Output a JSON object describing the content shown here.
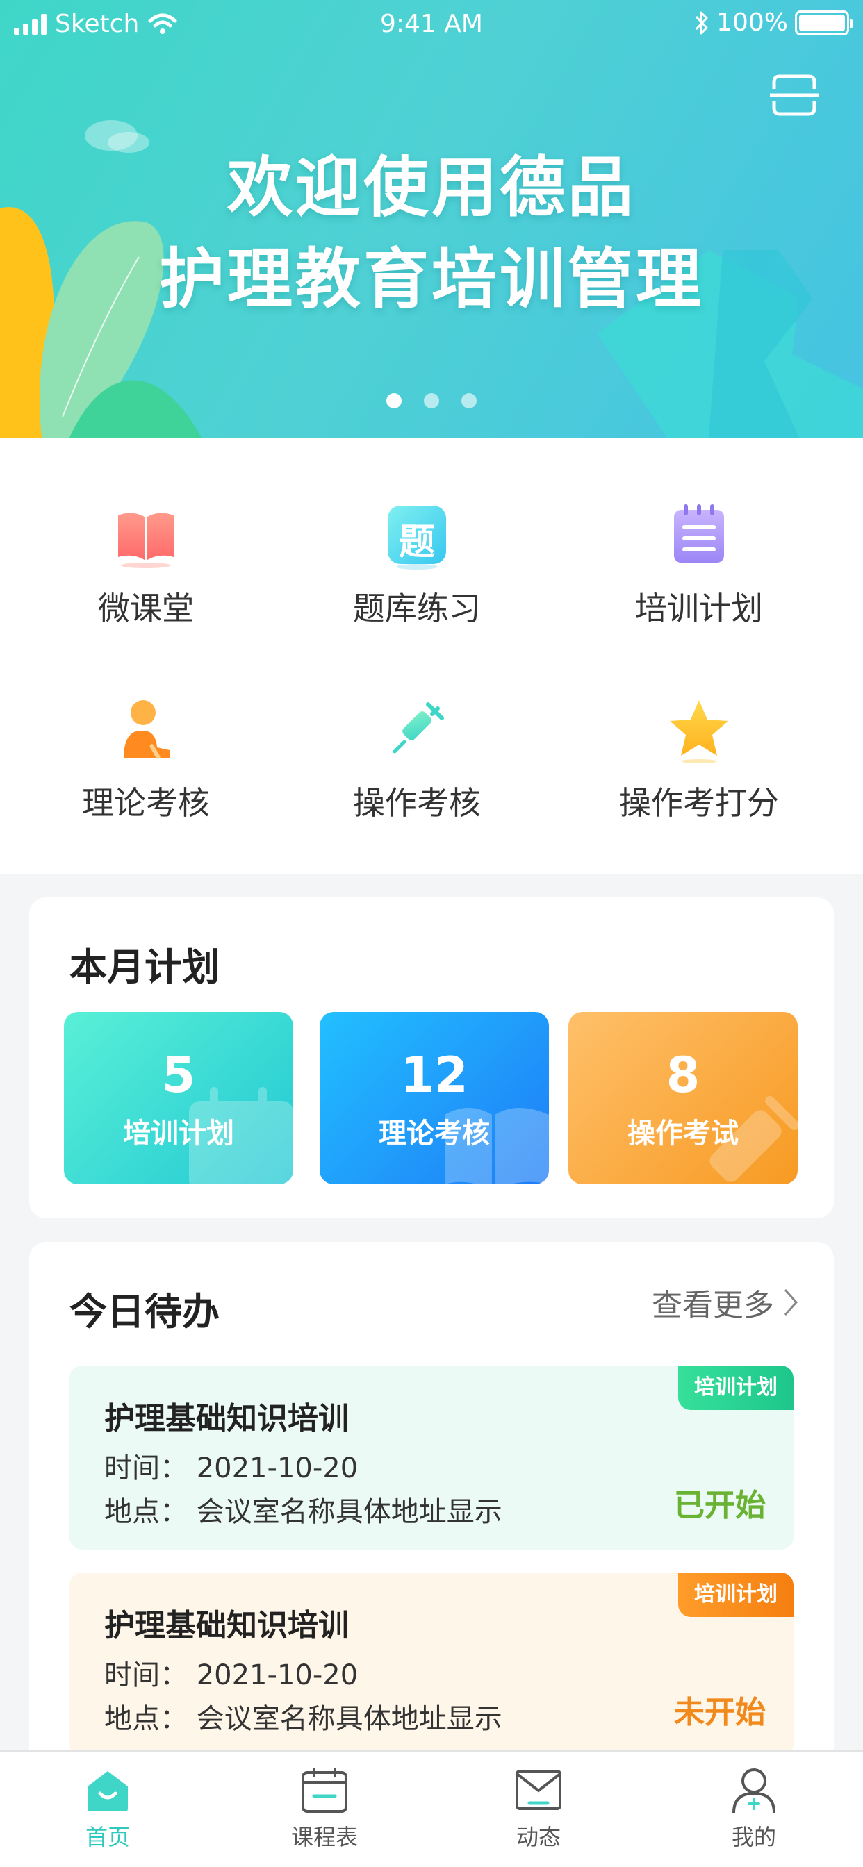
{
  "status_bar": {
    "carrier": "Sketch",
    "time": "9:41 AM",
    "battery": "100%"
  },
  "banner": {
    "title_line1": "欢迎使用德品",
    "title_line2": "护理教育培训管理",
    "dots": 3,
    "active_dot": 0
  },
  "menu": {
    "items": [
      {
        "label": "微课堂",
        "icon": "book-icon"
      },
      {
        "label": "题库练习",
        "icon": "question-bank-icon",
        "glyph": "题"
      },
      {
        "label": "培训计划",
        "icon": "notepad-icon"
      },
      {
        "label": "理论考核",
        "icon": "person-writing-icon"
      },
      {
        "label": "操作考核",
        "icon": "syringe-icon"
      },
      {
        "label": "操作考打分",
        "icon": "star-icon"
      }
    ]
  },
  "plan": {
    "title": "本月计划",
    "stats": [
      {
        "value": "5",
        "label": "培训计划"
      },
      {
        "value": "12",
        "label": "理论考核"
      },
      {
        "value": "8",
        "label": "操作考试"
      }
    ]
  },
  "todo": {
    "title": "今日待办",
    "more_label": "查看更多",
    "items": [
      {
        "title": "护理基础知识培训",
        "time": "时间：  2021-10-20",
        "place": "地点：  会议室名称具体地址显示",
        "tag": "培训计划",
        "status": "已开始"
      },
      {
        "title": "护理基础知识培训",
        "time": "时间：  2021-10-20",
        "place": "地点：  会议室名称具体地址显示",
        "tag": "培训计划",
        "status": "未开始"
      }
    ]
  },
  "tabbar": {
    "tabs": [
      {
        "label": "首页",
        "icon": "home-icon"
      },
      {
        "label": "课程表",
        "icon": "calendar-icon"
      },
      {
        "label": "动态",
        "icon": "mail-icon"
      },
      {
        "label": "我的",
        "icon": "profile-icon"
      }
    ],
    "active": 0
  },
  "colors": {
    "accent": "#2ec9bd",
    "started": "#6ab234",
    "not_started": "#f08a1c"
  }
}
